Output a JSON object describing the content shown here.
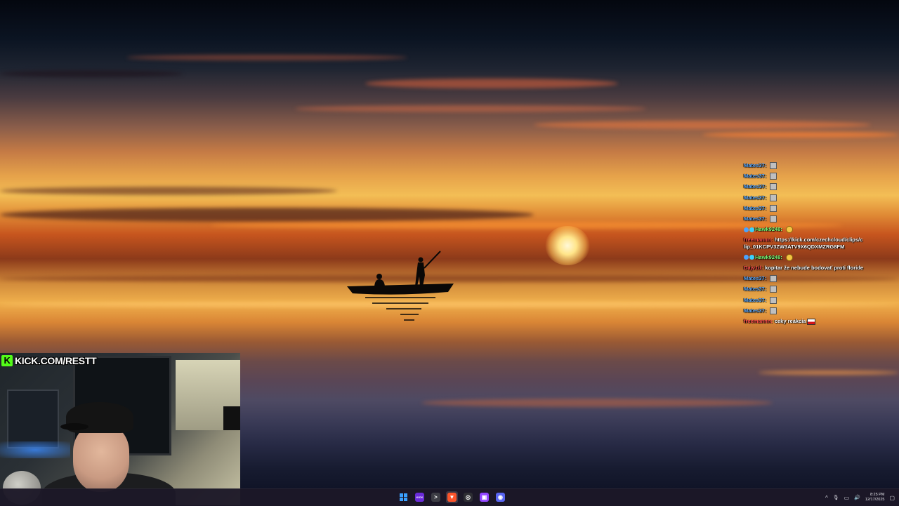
{
  "stream_overlay": {
    "kick_url": "KICK.COM/RESTT",
    "kick_logo_letter": "K"
  },
  "chat": {
    "messages": [
      {
        "user": "Mates37:",
        "text": "",
        "color": "#5aa9ff",
        "emote": "square-emote"
      },
      {
        "user": "Mates37:",
        "text": "",
        "color": "#5aa9ff",
        "emote": "square-emote"
      },
      {
        "user": "Mates37:",
        "text": "",
        "color": "#5aa9ff",
        "emote": "square-emote"
      },
      {
        "user": "Mates37:",
        "text": "",
        "color": "#5aa9ff",
        "emote": "square-emote"
      },
      {
        "user": "Mates37:",
        "text": "",
        "color": "#5aa9ff",
        "emote": "square-emote"
      },
      {
        "user": "Mates37:",
        "text": "",
        "color": "#5aa9ff",
        "emote": "square-emote"
      },
      {
        "user": "Hawk9248:",
        "text": "",
        "color": "#7dff7a",
        "emote": "yellow-face-emote"
      },
      {
        "user": "freemannn:",
        "text": "https://kick.com/czechcloud/clips/clip_01KCPV3ZW3ATV9X6QDXMZRG8FM",
        "color": "#ff4d4d"
      },
      {
        "user": "Hawk9248:",
        "text": "",
        "color": "#7dff7a",
        "emote": "yellow-face-emote"
      },
      {
        "user": "Dajv1d:",
        "text": "kopitar že nebude bodovať proti floride",
        "color": "#ff4d4d"
      },
      {
        "user": "Mates37:",
        "text": "",
        "color": "#5aa9ff",
        "emote": "square-emote"
      },
      {
        "user": "Mates37:",
        "text": "",
        "color": "#5aa9ff",
        "emote": "square-emote"
      },
      {
        "user": "Mates37:",
        "text": "",
        "color": "#5aa9ff",
        "emote": "square-emote"
      },
      {
        "user": "Mates37:",
        "text": "",
        "color": "#5aa9ff",
        "emote": "square-emote"
      },
      {
        "user": "freemannn:",
        "text": "ceky reakcia",
        "color": "#ff4d4d",
        "emote": "czech-flag-emote"
      }
    ]
  },
  "taskbar": {
    "apps": [
      {
        "name": "start-button",
        "glyph": "",
        "color": "#3aa0ff"
      },
      {
        "name": "kick-app-icon",
        "glyph": "KICK",
        "color": "#6a2bd9"
      },
      {
        "name": "terminal-app-icon",
        "glyph": ">",
        "color": "#3c3c44"
      },
      {
        "name": "brave-browser-icon",
        "glyph": "▼",
        "color": "#fb542b"
      },
      {
        "name": "obs-app-icon",
        "glyph": "◎",
        "color": "#2d2d33"
      },
      {
        "name": "twitch-app-icon",
        "glyph": "▣",
        "color": "#9146ff"
      },
      {
        "name": "discord-app-icon",
        "glyph": "◉",
        "color": "#5865f2"
      }
    ],
    "tray": {
      "chevron": "^",
      "mic": "🎙",
      "network": "▭",
      "volume": "🔊",
      "time": "8:25 PM",
      "date": "12/17/2025",
      "notification": "▢"
    }
  }
}
